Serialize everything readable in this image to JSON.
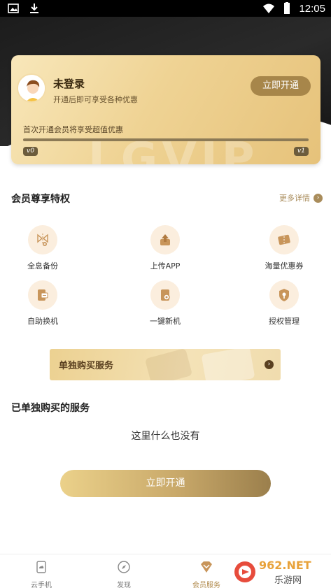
{
  "status_bar": {
    "time": "12:05"
  },
  "vip_card": {
    "username": "未登录",
    "subtitle": "开通后即可享受各种优惠",
    "open_button": "立即开通",
    "first_open_text": "首次开通会员将享受超值优惠",
    "level_start": "v0",
    "level_end": "v1",
    "watermark": "LGVIP"
  },
  "privileges": {
    "title": "会员尊享特权",
    "more": "更多详情",
    "items": [
      {
        "label": "全息备份",
        "icon": "backup-icon"
      },
      {
        "label": "上传APP",
        "icon": "upload-icon"
      },
      {
        "label": "海量优惠券",
        "icon": "coupon-icon"
      },
      {
        "label": "自助换机",
        "icon": "switch-device-icon"
      },
      {
        "label": "一键新机",
        "icon": "new-device-icon"
      },
      {
        "label": "授权管理",
        "icon": "shield-icon"
      }
    ]
  },
  "single_service_banner": {
    "label": "单独购买服务"
  },
  "purchased": {
    "title": "已单独购买的服务",
    "empty_text": "这里什么也没有"
  },
  "open_button_bottom": "立即开通",
  "bottom_nav": [
    {
      "label": "云手机",
      "icon": "cloud-phone-icon"
    },
    {
      "label": "发现",
      "icon": "compass-icon"
    },
    {
      "label": "会员服务",
      "icon": "vip-icon",
      "active": true
    }
  ],
  "watermark_logo": {
    "text": "962.NET",
    "sub": "乐游网"
  },
  "colors": {
    "gold": "#b08a4c",
    "dark": "#1c1c1c"
  }
}
